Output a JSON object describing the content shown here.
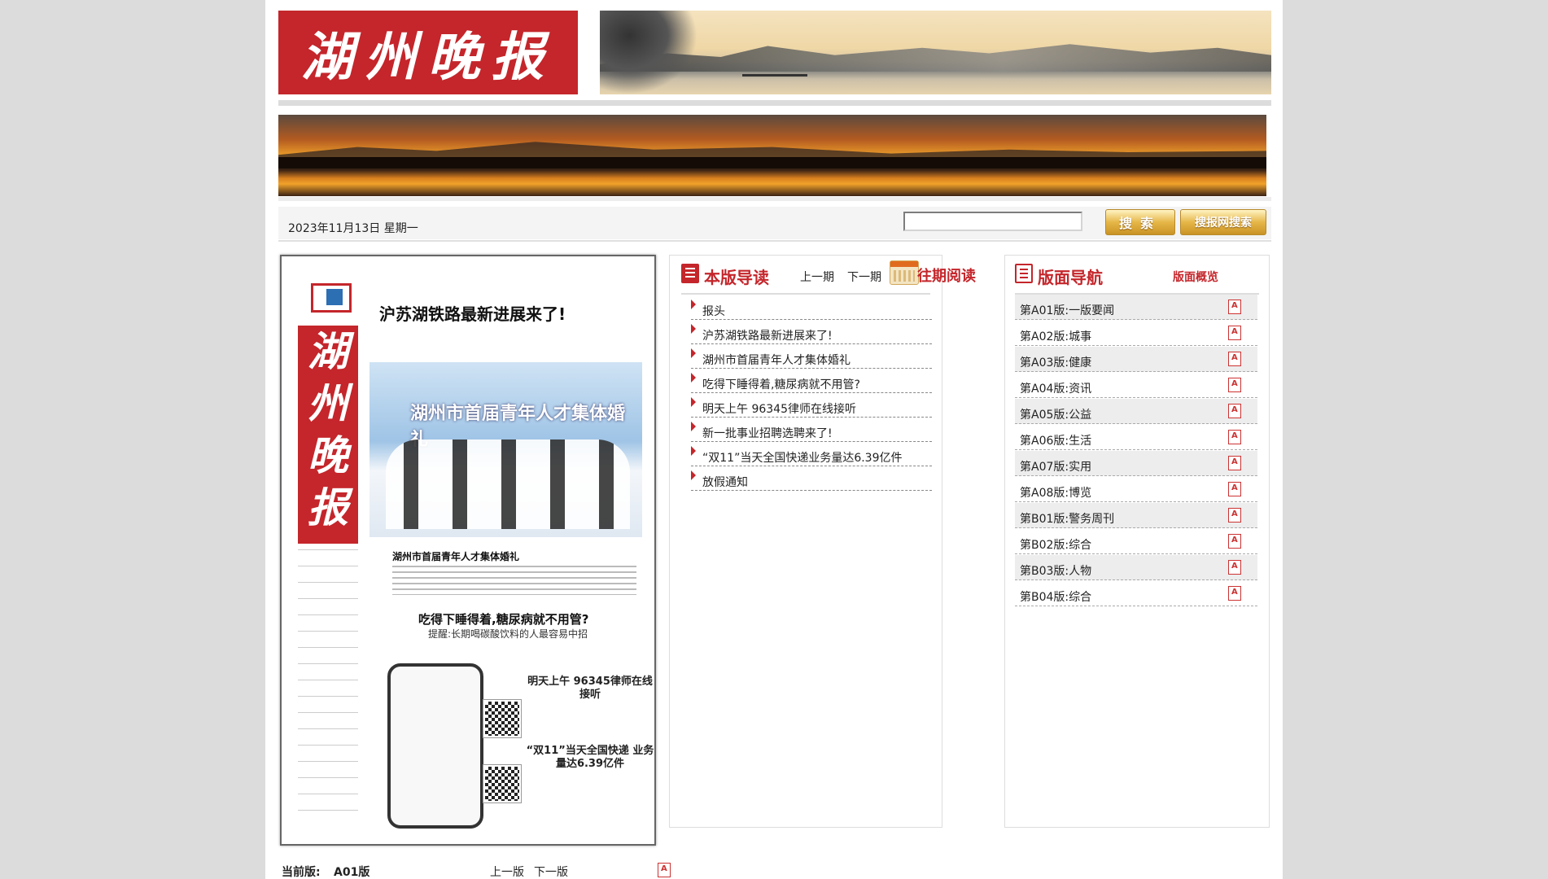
{
  "brand": {
    "title": "湖州晚报"
  },
  "toolbar": {
    "date": "2023年11月13日 星期一",
    "search_placeholder": "",
    "search_button": "搜索",
    "site_search_button": "搜报网搜索"
  },
  "paper_preview": {
    "masthead": "湖州晚报",
    "headline": "沪苏湖铁路最新进展来了!",
    "photo_title": "湖州市首届青年人才集体婚礼",
    "photo_caption": "湖州市首届青年人才集体婚礼",
    "health_headline": "吃得下睡得着,糖尿病就不用管?",
    "health_sub": "提醒:长期喝碳酸饮料的人最容易中招",
    "lawyer_headline": "明天上午 96345律师在线接听",
    "express_headline": "“双11”当天全国快递 业务量达6.39亿件"
  },
  "current": {
    "label": "当前版:",
    "value": "A01版",
    "prev": "上一版",
    "next": "下一版"
  },
  "guide": {
    "title": "本版导读",
    "prev": "上一期",
    "next": "下一期",
    "archive": "往期阅读",
    "articles": [
      "报头",
      "沪苏湖铁路最新进展来了!",
      "湖州市首届青年人才集体婚礼",
      "吃得下睡得着,糖尿病就不用管?",
      "明天上午 96345律师在线接听",
      "新一批事业招聘选聘来了!",
      "“双11”当天全国快递业务量达6.39亿件",
      "放假通知"
    ]
  },
  "nav": {
    "title": "版面导航",
    "overview": "版面概览",
    "editions": [
      "第A01版:一版要闻",
      "第A02版:城事",
      "第A03版:健康",
      "第A04版:资讯",
      "第A05版:公益",
      "第A06版:生活",
      "第A07版:实用",
      "第A08版:博览",
      "第B01版:警务周刊",
      "第B02版:综合",
      "第B03版:人物",
      "第B04版:综合"
    ]
  },
  "colors": {
    "brand_red": "#c4262b",
    "gold": "#e6b748"
  }
}
